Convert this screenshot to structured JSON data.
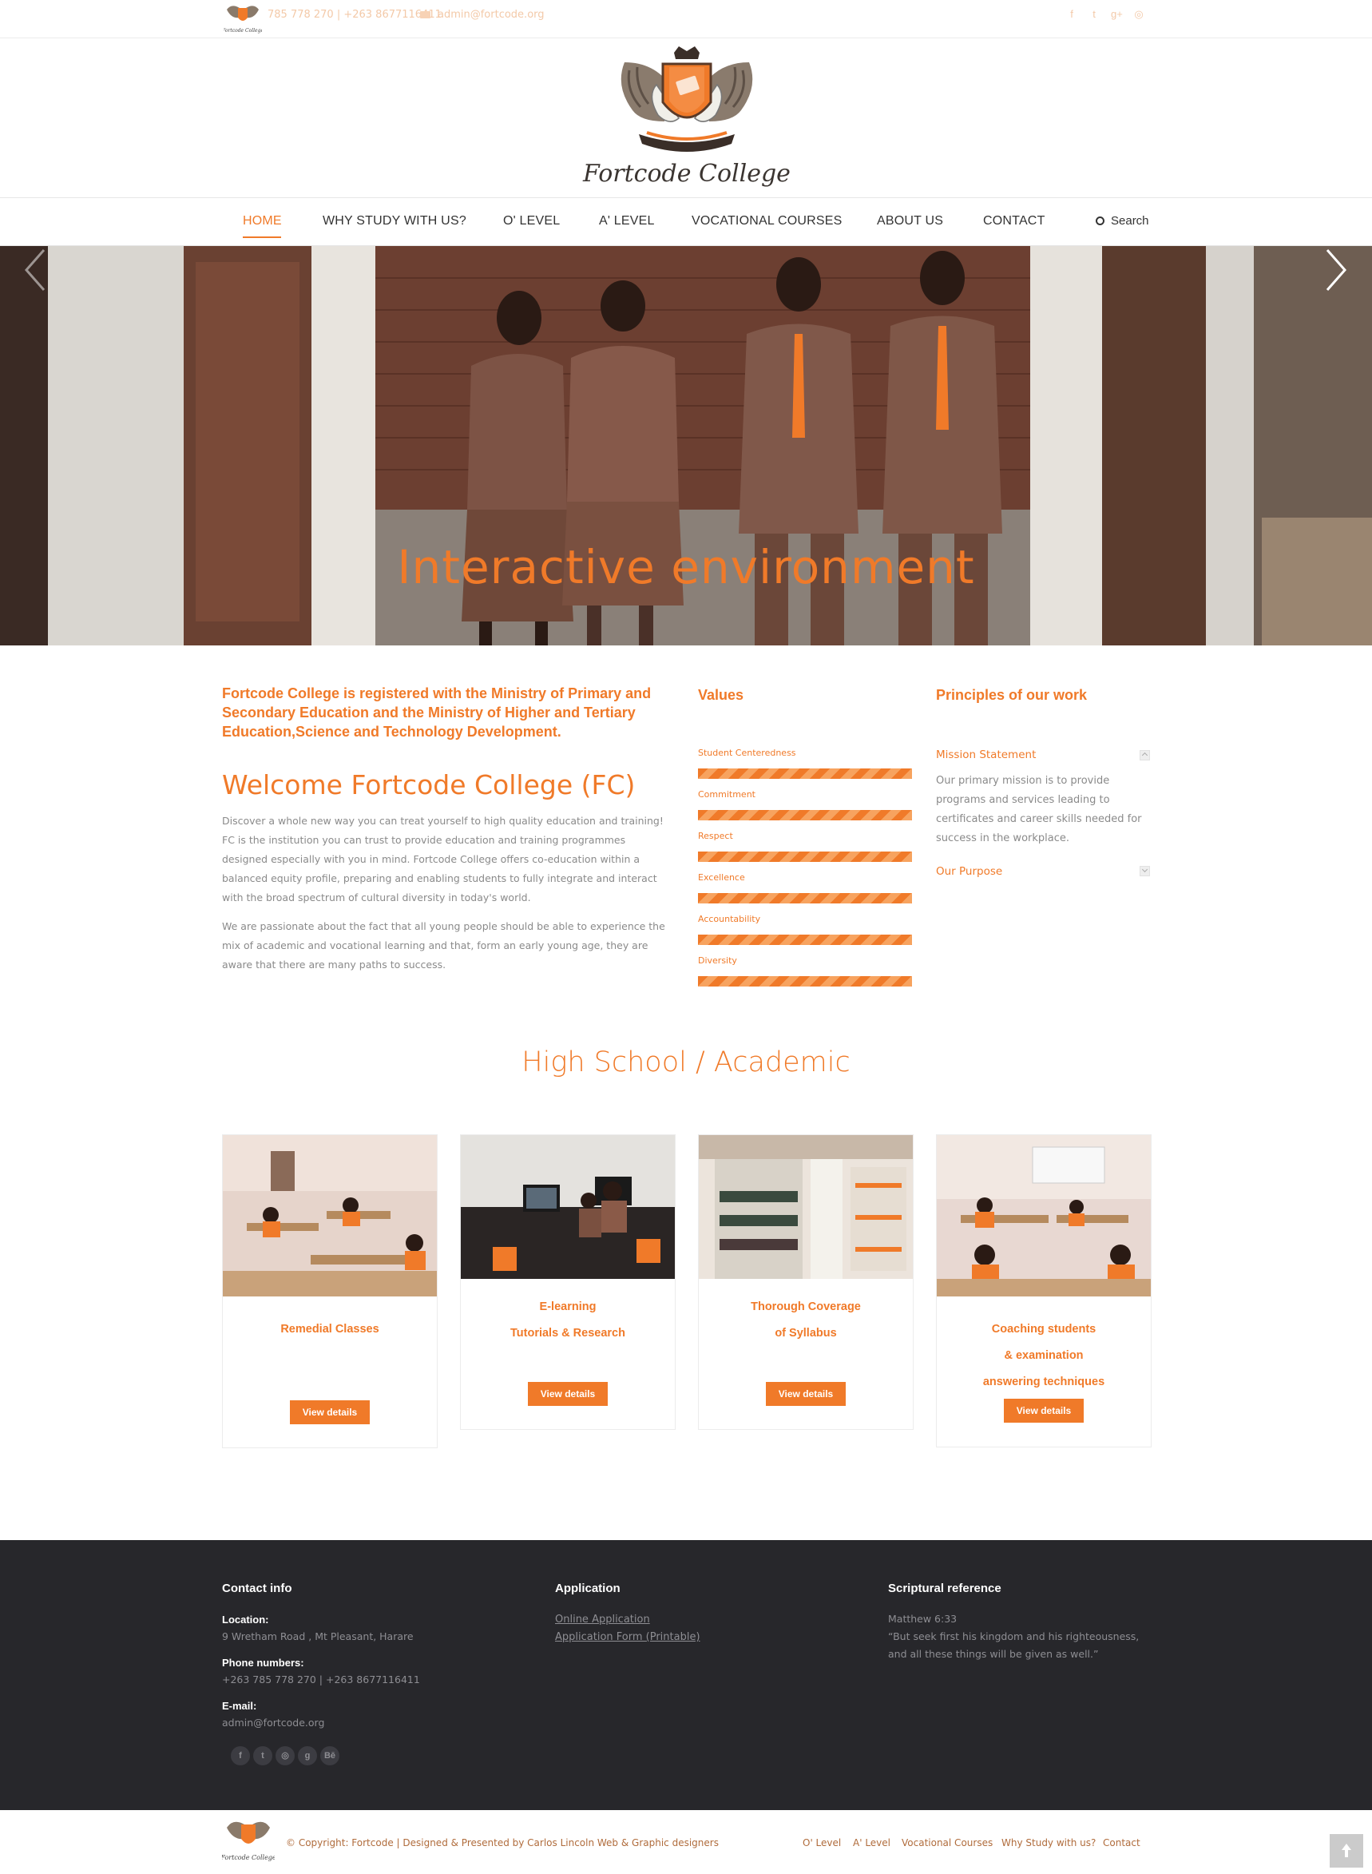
{
  "topbar": {
    "phone": "785 778 270 | +263 8677116411",
    "email": "admin@fortcode.org",
    "social": [
      "f",
      "t",
      "g+",
      "◎"
    ]
  },
  "header": {
    "college_name": "Fortcode College"
  },
  "nav": {
    "items": [
      "HOME",
      "WHY STUDY WITH US?",
      "O' LEVEL",
      "A' LEVEL",
      "VOCATIONAL COURSES",
      "ABOUT US",
      "CONTACT"
    ],
    "search": "Search"
  },
  "hero": {
    "caption": "Interactive environment"
  },
  "intro": {
    "heading": "Fortcode College is registered with the Ministry of Primary and Secondary Education and the Ministry of Higher and Tertiary Education,Science and Technology Development.",
    "welcome": "Welcome Fortcode College (FC)",
    "p1": "Discover a whole new way you can treat yourself to high quality education and training!  FC is the institution you can trust to provide education and training programmes designed especially with you in mind. Fortcode College offers co-education within a balanced equity profile, preparing and enabling students to fully integrate and interact with the broad spectrum of cultural diversity in today's world.",
    "p2": "We are passionate about the fact that all young people should be able to experience the mix of academic and vocational learning and that, form an early young age, they are aware that there are many paths to success."
  },
  "values": {
    "title": "Values",
    "items": [
      {
        "label": "Student Centeredness",
        "level": 100
      },
      {
        "label": "Commitment",
        "level": 100
      },
      {
        "label": "Respect",
        "level": 100
      },
      {
        "label": "Excellence",
        "level": 100
      },
      {
        "label": "Accountability",
        "level": 100
      },
      {
        "label": "Diversity",
        "level": 100
      }
    ]
  },
  "principles": {
    "title": "Principles of our work",
    "mission_title": "Mission Statement",
    "mission_body": "Our primary mission is to provide programs and services leading to certificates and career skills needed for success in the workplace.",
    "purpose_title": "Our Purpose"
  },
  "section": {
    "title": "High School / Academic",
    "cards": [
      {
        "lines": [
          "Remedial Classes"
        ],
        "button": "View details"
      },
      {
        "lines": [
          "E-learning",
          "Tutorials & Research"
        ],
        "button": "View details"
      },
      {
        "lines": [
          "Thorough Coverage",
          "of Syllabus"
        ],
        "button": "View details"
      },
      {
        "lines": [
          "Coaching students",
          "& examination",
          "answering techniques"
        ],
        "button": "View details"
      }
    ]
  },
  "footer": {
    "contact_title": "Contact info",
    "location_label": "Location:",
    "location": "9 Wretham Road , Mt Pleasant, Harare",
    "phone_label": "Phone numbers:",
    "phones": "+263 785 778 270 | +263 8677116411",
    "email_label": "E-mail:",
    "email": "admin@fortcode.org",
    "application_title": "Application",
    "links": [
      "Online Application",
      "Application Form (Printable)"
    ],
    "scripture_title": "Scriptural reference",
    "verse_ref": "Matthew 6:33",
    "verse_text": "“But seek first his kingdom and his righteousness, and all these things will be given as well.”",
    "social": [
      "f",
      "t",
      "◎",
      "g",
      "Bē"
    ]
  },
  "bottom": {
    "copyright": "© Copyright: Fortcode | Designed & Presented by Carlos Lincoln Web & Graphic designers",
    "links": [
      "O' Level",
      "A' Level",
      "Vocational Courses",
      "Why Study with us?",
      "Contact"
    ]
  },
  "colors": {
    "accent": "#f07a29",
    "footer_bg": "#27272b"
  }
}
